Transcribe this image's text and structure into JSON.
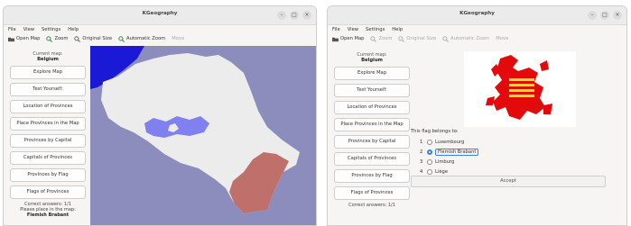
{
  "left_window": {
    "title": "KGeography",
    "menu": [
      "File",
      "View",
      "Settings",
      "Help"
    ],
    "toolbar": {
      "open_map": "Open Map",
      "zoom": "Zoom",
      "original_size": "Original Size",
      "automatic_zoom": "Automatic Zoom",
      "move": "Move"
    },
    "current_map_label": "Current map:",
    "current_map": "Belgium",
    "buttons": [
      "Explore Map",
      "Test Yourself:",
      "Location of Provinces",
      "Place Provinces in the Map",
      "Provinces by Capital",
      "Capitals of Provinces",
      "Provinces by Flag",
      "Flags of Provinces"
    ],
    "correct_answers": "Correct answers: 1/1",
    "place_prompt": "Please place in the map:",
    "place_target": "Flemish Brabant"
  },
  "right_window": {
    "title": "KGeography",
    "menu": [
      "File",
      "View",
      "Settings",
      "Help"
    ],
    "toolbar": {
      "open_map": "Open Map",
      "zoom": "Zoom",
      "original_size": "Original Size",
      "automatic_zoom": "Automatic Zoom",
      "move": "Move"
    },
    "current_map_label": "Current map:",
    "current_map": "Belgium",
    "buttons": [
      "Explore Map",
      "Test Yourself:",
      "Location of Provinces",
      "Place Provinces in the Map",
      "Provinces by Capital",
      "Capitals of Provinces",
      "Provinces by Flag",
      "Flags of Provinces"
    ],
    "correct_answers": "Correct answers: 1/1",
    "question": "This flag belongs to:",
    "options": [
      {
        "num": "1",
        "label": "Luxembourg"
      },
      {
        "num": "2",
        "label": "Flemish Brabant"
      },
      {
        "num": "3",
        "label": "Limburg"
      },
      {
        "num": "4",
        "label": "Liège"
      }
    ],
    "selected_option": 2,
    "accept": "Accept"
  },
  "colors": {
    "sea": "#1a1ad6",
    "land": "#ececec",
    "background_map": "#8c8cbd",
    "highlight_brabant": "#8080f0",
    "highlight_luxembourg": "#c0706a",
    "flag_red": "#e20a0a",
    "flag_yellow": "#f5e61a",
    "accent": "#3584e4"
  }
}
